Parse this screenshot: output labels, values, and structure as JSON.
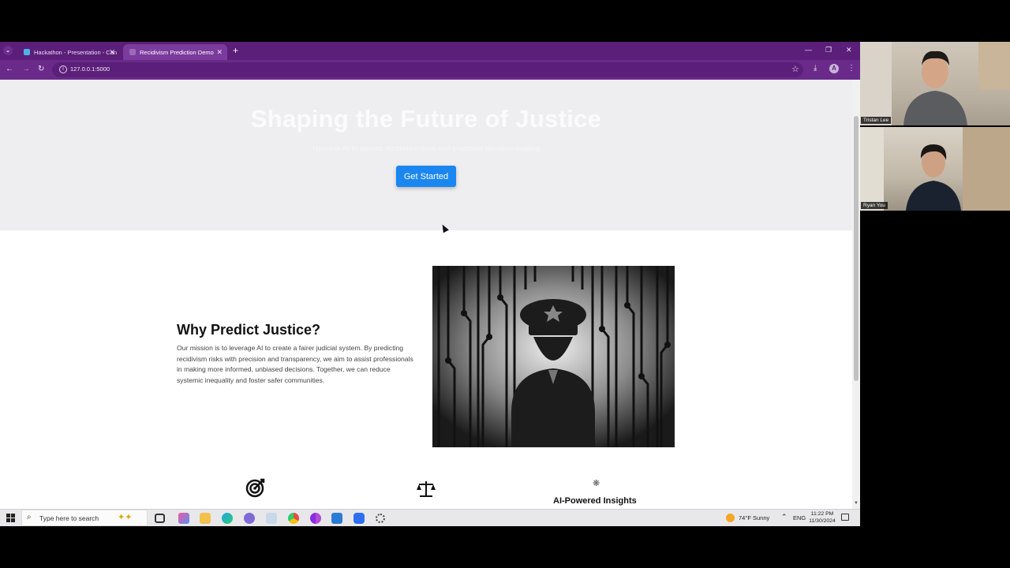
{
  "browser": {
    "tabs": [
      {
        "label": "Hackathon - Presentation - Can",
        "active": false
      },
      {
        "label": "Recidivism Prediction Demo",
        "active": true
      }
    ],
    "url": "127.0.0.1:5000"
  },
  "hero": {
    "title": "Shaping the Future of Justice",
    "subtitle": "Harness AI to assess recidivism risks and empower decision-making",
    "cta_label": "Get Started"
  },
  "why": {
    "title": "Why Predict Justice?",
    "body": "Our mission is to leverage AI to create a fairer judicial system. By predicting recidivism risks with precision and transparency, we aim to assist professionals in making more informed, unbiased decisions. Together, we can reduce systemic inequality and foster safer communities."
  },
  "features": [
    {
      "icon": "target-icon",
      "title": ""
    },
    {
      "icon": "scales-icon",
      "title": ""
    },
    {
      "icon": "brain-icon",
      "title": "AI-Powered Insights"
    }
  ],
  "taskbar": {
    "search_placeholder": "Type here to search",
    "weather": "74°F  Sunny",
    "language": "ENG",
    "time": "11:22 PM",
    "date": "11/30/2024"
  },
  "participants": [
    {
      "name": "Tristan Lee"
    },
    {
      "name": "Ryan You"
    }
  ],
  "colors": {
    "browser_frame": "#5b1f7a",
    "cta": "#1a86f0",
    "hero_bg": "#eeeef1"
  }
}
